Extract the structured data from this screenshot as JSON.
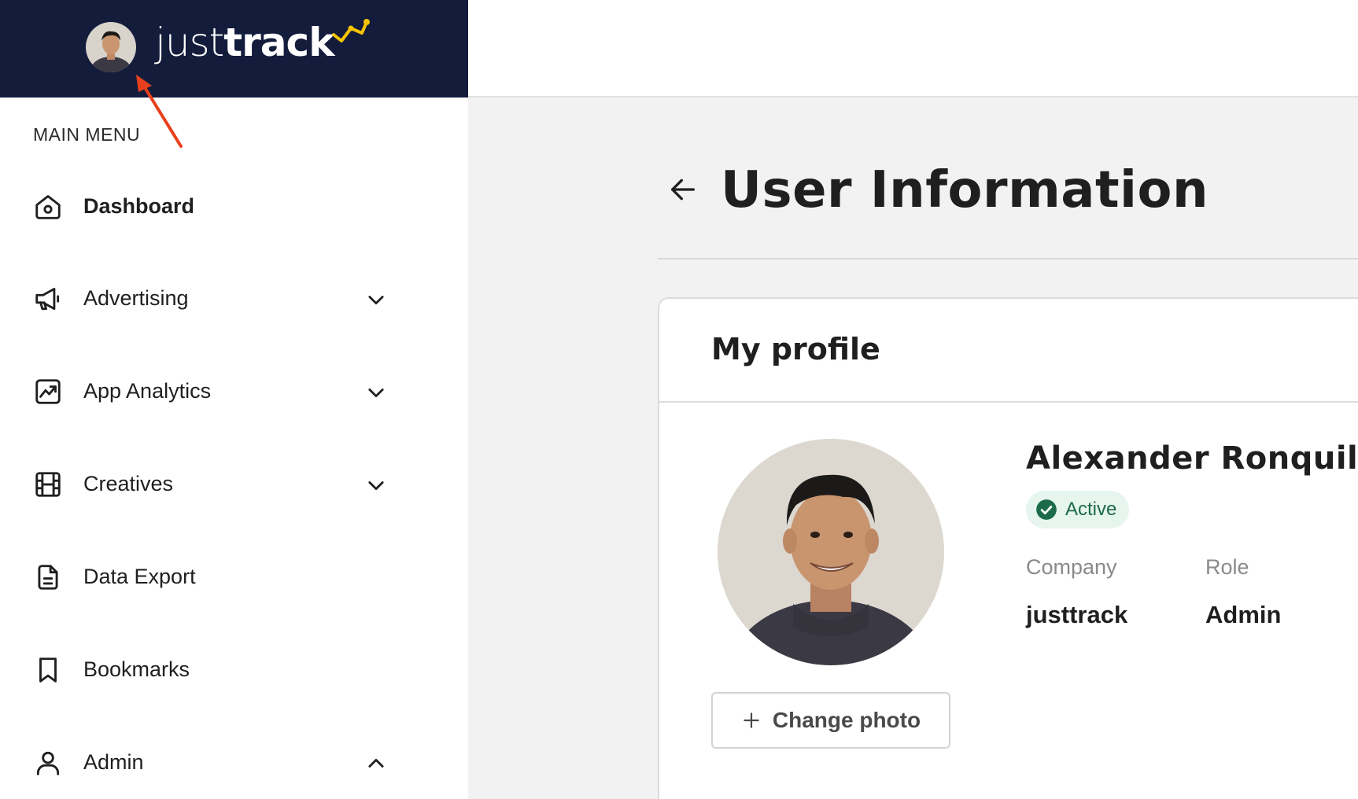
{
  "brand": {
    "logo_light": "just",
    "logo_bold": "track",
    "accent_color": "#f5c400",
    "bar_color": "#141c3c"
  },
  "sidebar": {
    "heading": "MAIN MENU",
    "items": [
      {
        "label": "Dashboard",
        "icon": "home-icon",
        "active": true,
        "expandable": false
      },
      {
        "label": "Advertising",
        "icon": "megaphone-icon",
        "expandable": true,
        "expanded": false
      },
      {
        "label": "App Analytics",
        "icon": "chart-icon",
        "expandable": true,
        "expanded": false
      },
      {
        "label": "Creatives",
        "icon": "film-icon",
        "expandable": true,
        "expanded": false
      },
      {
        "label": "Data Export",
        "icon": "document-icon",
        "expandable": false
      },
      {
        "label": "Bookmarks",
        "icon": "bookmark-icon",
        "expandable": false
      },
      {
        "label": "Admin",
        "icon": "user-icon",
        "expandable": true,
        "expanded": true
      }
    ]
  },
  "page": {
    "title": "User Information"
  },
  "profile": {
    "card_title": "My profile",
    "name": "Alexander Ronquillo",
    "status": "Active",
    "status_color": "#1d6b4a",
    "fields": [
      {
        "label": "Company",
        "value": "justtrack"
      },
      {
        "label": "Role",
        "value": "Admin"
      }
    ],
    "change_photo_label": "Change photo"
  }
}
